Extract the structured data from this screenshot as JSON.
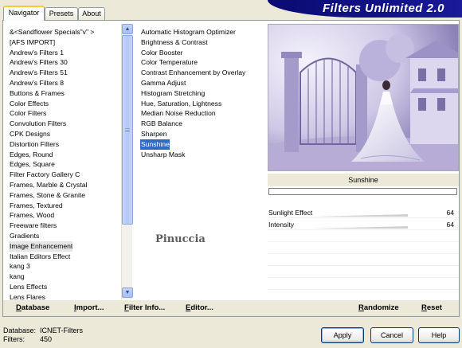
{
  "tabs": [
    "Navigator",
    "Presets",
    "About"
  ],
  "banner_title": "Filters Unlimited 2.0",
  "categories": [
    "&<Sandflower Specials\"v\" >",
    "[AFS IMPORT]",
    "Andrew's Filters 1",
    "Andrew's Filters 30",
    "Andrew's Filters 51",
    "Andrew's Filters 8",
    "Buttons & Frames",
    "Color Effects",
    "Color Filters",
    "Convolution Filters",
    "CPK Designs",
    "Distortion Filters",
    "Edges, Round",
    "Edges, Square",
    "Filter Factory Gallery C",
    "Frames, Marble & Crystal",
    "Frames, Stone & Granite",
    "Frames, Textured",
    "Frames, Wood",
    "Freeware filters",
    "Gradients",
    "Image Enhancement",
    "Italian Editors Effect",
    "kang 3",
    "kang",
    "Lens Effects",
    "Lens Flares"
  ],
  "selected_category": "Image Enhancement",
  "filters": [
    "Automatic Histogram Optimizer",
    "Brightness & Contrast",
    "Color Booster",
    "Color Temperature",
    "Contrast Enhancement by Overlay",
    "Gamma Adjust",
    "Histogram Stretching",
    "Hue, Saturation, Lightness",
    "Median Noise Reduction",
    "RGB Balance",
    "Sharpen",
    "Sunshine",
    "Unsharp Mask"
  ],
  "selected_filter": "Sunshine",
  "watermark": "Pinuccia",
  "preview_filter_name": "Sunshine",
  "parameters": [
    {
      "label": "Sunlight Effect",
      "value": "64"
    },
    {
      "label": "Intensity",
      "value": "64"
    }
  ],
  "links": {
    "database": "Database",
    "import": "Import...",
    "filter_info": "Filter Info...",
    "editor": "Editor...",
    "randomize": "Randomize",
    "reset": "Reset"
  },
  "status": {
    "database_label": "Database:",
    "database_value": "ICNET-Filters",
    "filters_label": "Filters:",
    "filters_value": "450"
  },
  "buttons": {
    "apply": "Apply",
    "cancel": "Cancel",
    "help": "Help"
  },
  "colors": {
    "selection_blue": "#316ac5",
    "banner_navy": "#0b0b72",
    "dialog_bg": "#ece9d8"
  }
}
